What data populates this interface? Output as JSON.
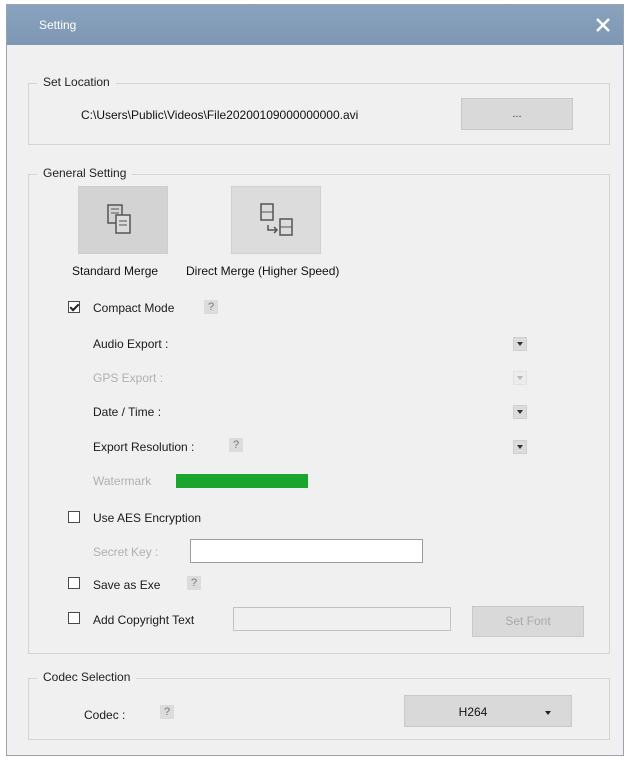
{
  "window": {
    "title": "Setting"
  },
  "set_location": {
    "group_label": "Set Location",
    "path": "C:\\Users\\Public\\Videos\\File20200109000000000.avi",
    "browse_label": "..."
  },
  "general": {
    "group_label": "General Setting",
    "merge_modes": [
      {
        "label": "Standard Merge",
        "icon": "standard-merge-icon",
        "selected": true
      },
      {
        "label": "Direct Merge (Higher Speed)",
        "icon": "direct-merge-icon",
        "selected": false
      }
    ],
    "compact_mode": {
      "label": "Compact Mode",
      "checked": true,
      "help": "?"
    },
    "audio_export": {
      "label": "Audio Export :",
      "enabled": true
    },
    "gps_export": {
      "label": "GPS Export :",
      "enabled": false
    },
    "date_time": {
      "label": "Date / Time :",
      "enabled": true
    },
    "export_resolution": {
      "label": "Export Resolution :",
      "help": "?",
      "enabled": true
    },
    "watermark": {
      "label": "Watermark",
      "color": "#1aa52e",
      "enabled": false
    },
    "aes": {
      "label": "Use AES Encryption",
      "checked": false
    },
    "secret_key": {
      "label": "Secret Key :",
      "value": "",
      "enabled": false
    },
    "save_exe": {
      "label": "Save as Exe",
      "checked": false,
      "help": "?"
    },
    "copyright": {
      "label": "Add Copyright Text",
      "checked": false,
      "value": "",
      "set_font_label": "Set Font"
    }
  },
  "codec": {
    "group_label": "Codec Selection",
    "label": "Codec :",
    "help": "?",
    "value": "H264"
  },
  "colors": {
    "titlebar": "#8aa2bd",
    "dialog_bg": "#f0f0f0",
    "button_bg": "#d9d9d9",
    "watermark": "#1aa52e"
  }
}
